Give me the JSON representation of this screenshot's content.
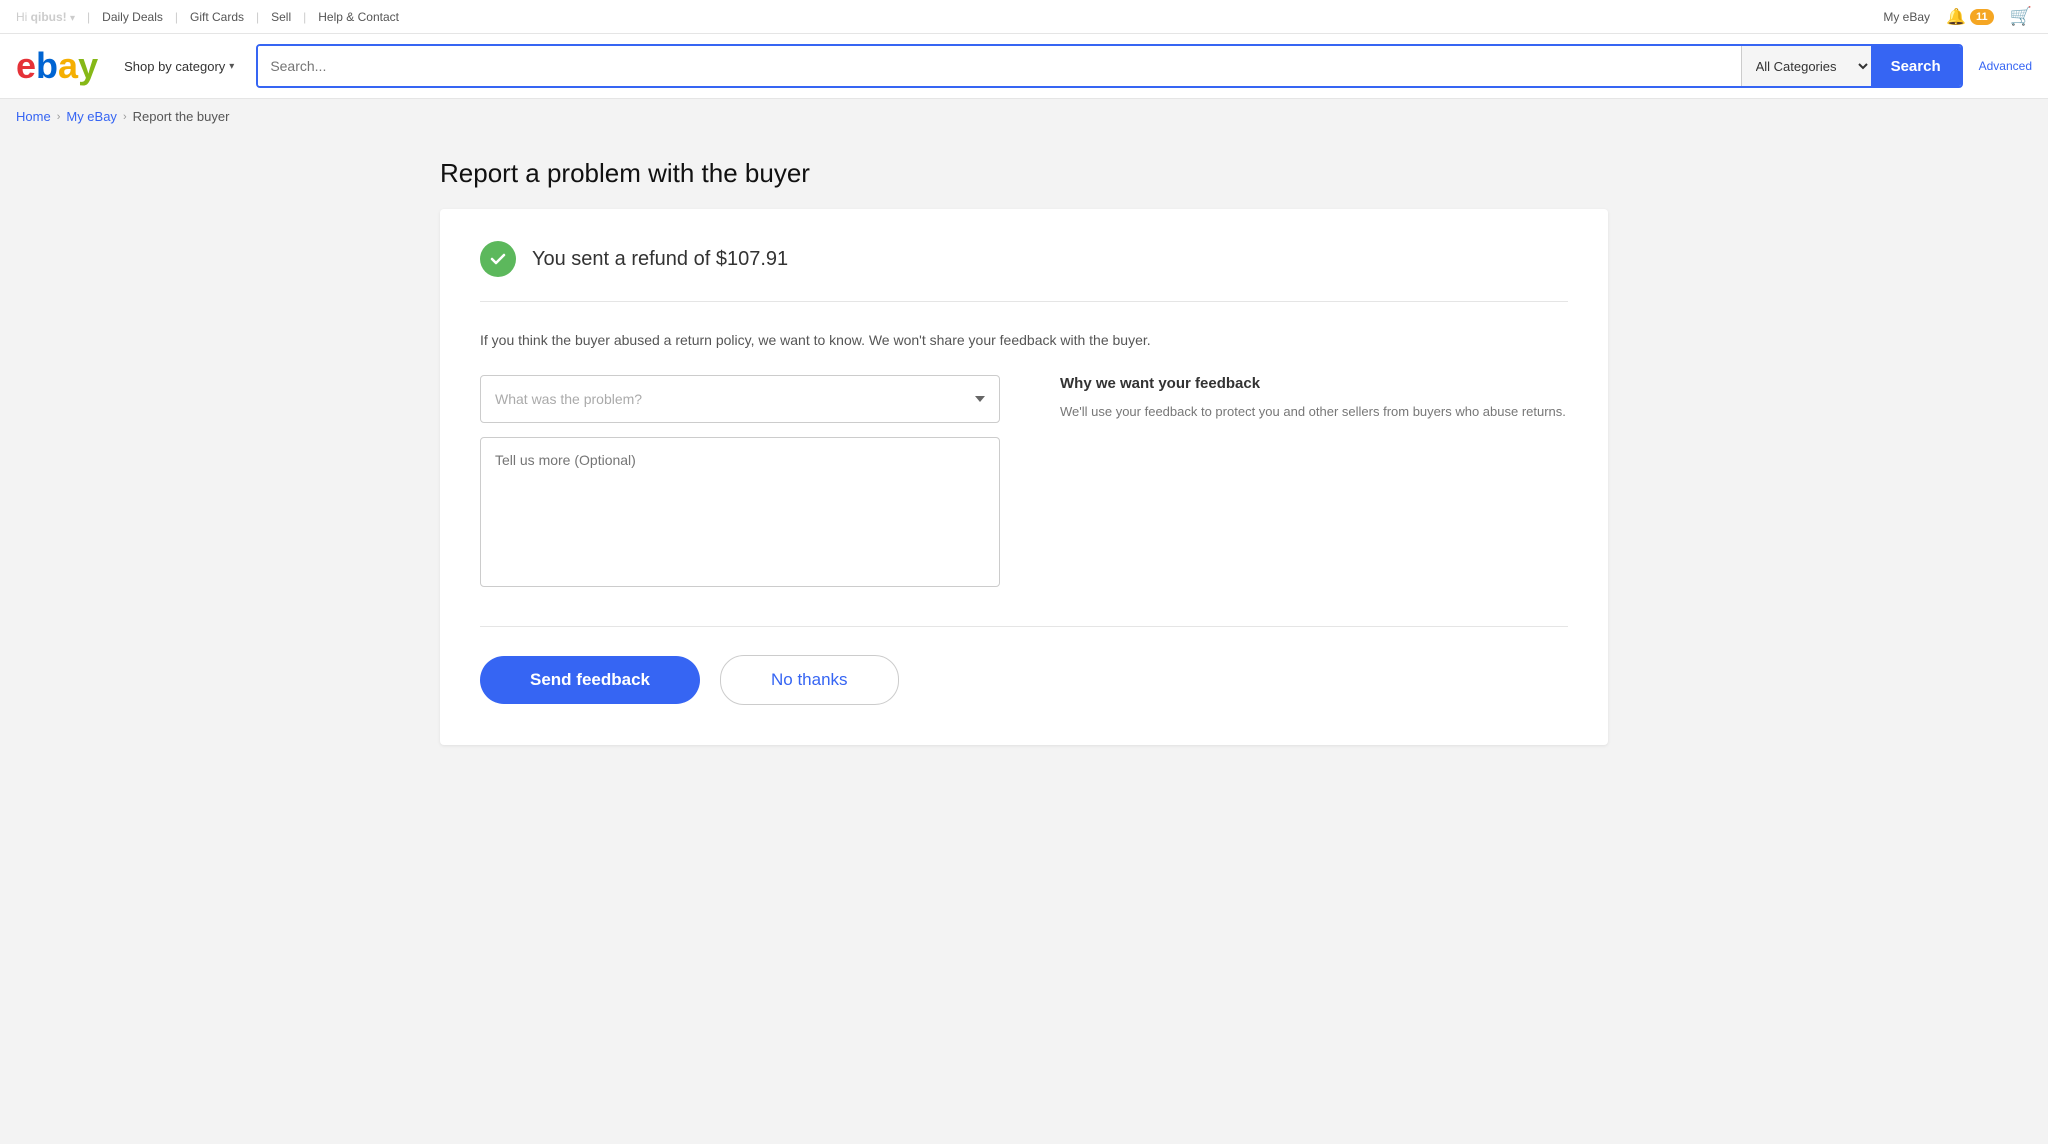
{
  "topbar": {
    "greeting": "Hi ",
    "username": "qibus!",
    "links": [
      "Daily Deals",
      "Gift Cards",
      "Sell",
      "Help & Contact"
    ],
    "myebay": "My eBay",
    "notification_count": "11"
  },
  "header": {
    "logo_letters": [
      "e",
      "b",
      "a",
      "y"
    ],
    "shop_by_category": "Shop by category",
    "search_placeholder": "Search...",
    "all_categories": "All Categories",
    "search_button": "Search",
    "advanced": "Advanced"
  },
  "breadcrumb": {
    "home": "Home",
    "myebay": "My eBay",
    "current": "Report the buyer"
  },
  "page": {
    "title": "Report a problem with the buyer",
    "refund_message": "You sent a refund of $107.91",
    "description": "If you think the buyer abused a return policy, we want to know. We won't share your feedback with the buyer.",
    "problem_placeholder": "What was the problem?",
    "tell_us_placeholder": "Tell us more (Optional)",
    "why_title": "Why we want your feedback",
    "why_text": "We'll use your feedback to protect you and other sellers from buyers who abuse returns.",
    "send_feedback": "Send feedback",
    "no_thanks": "No thanks"
  }
}
